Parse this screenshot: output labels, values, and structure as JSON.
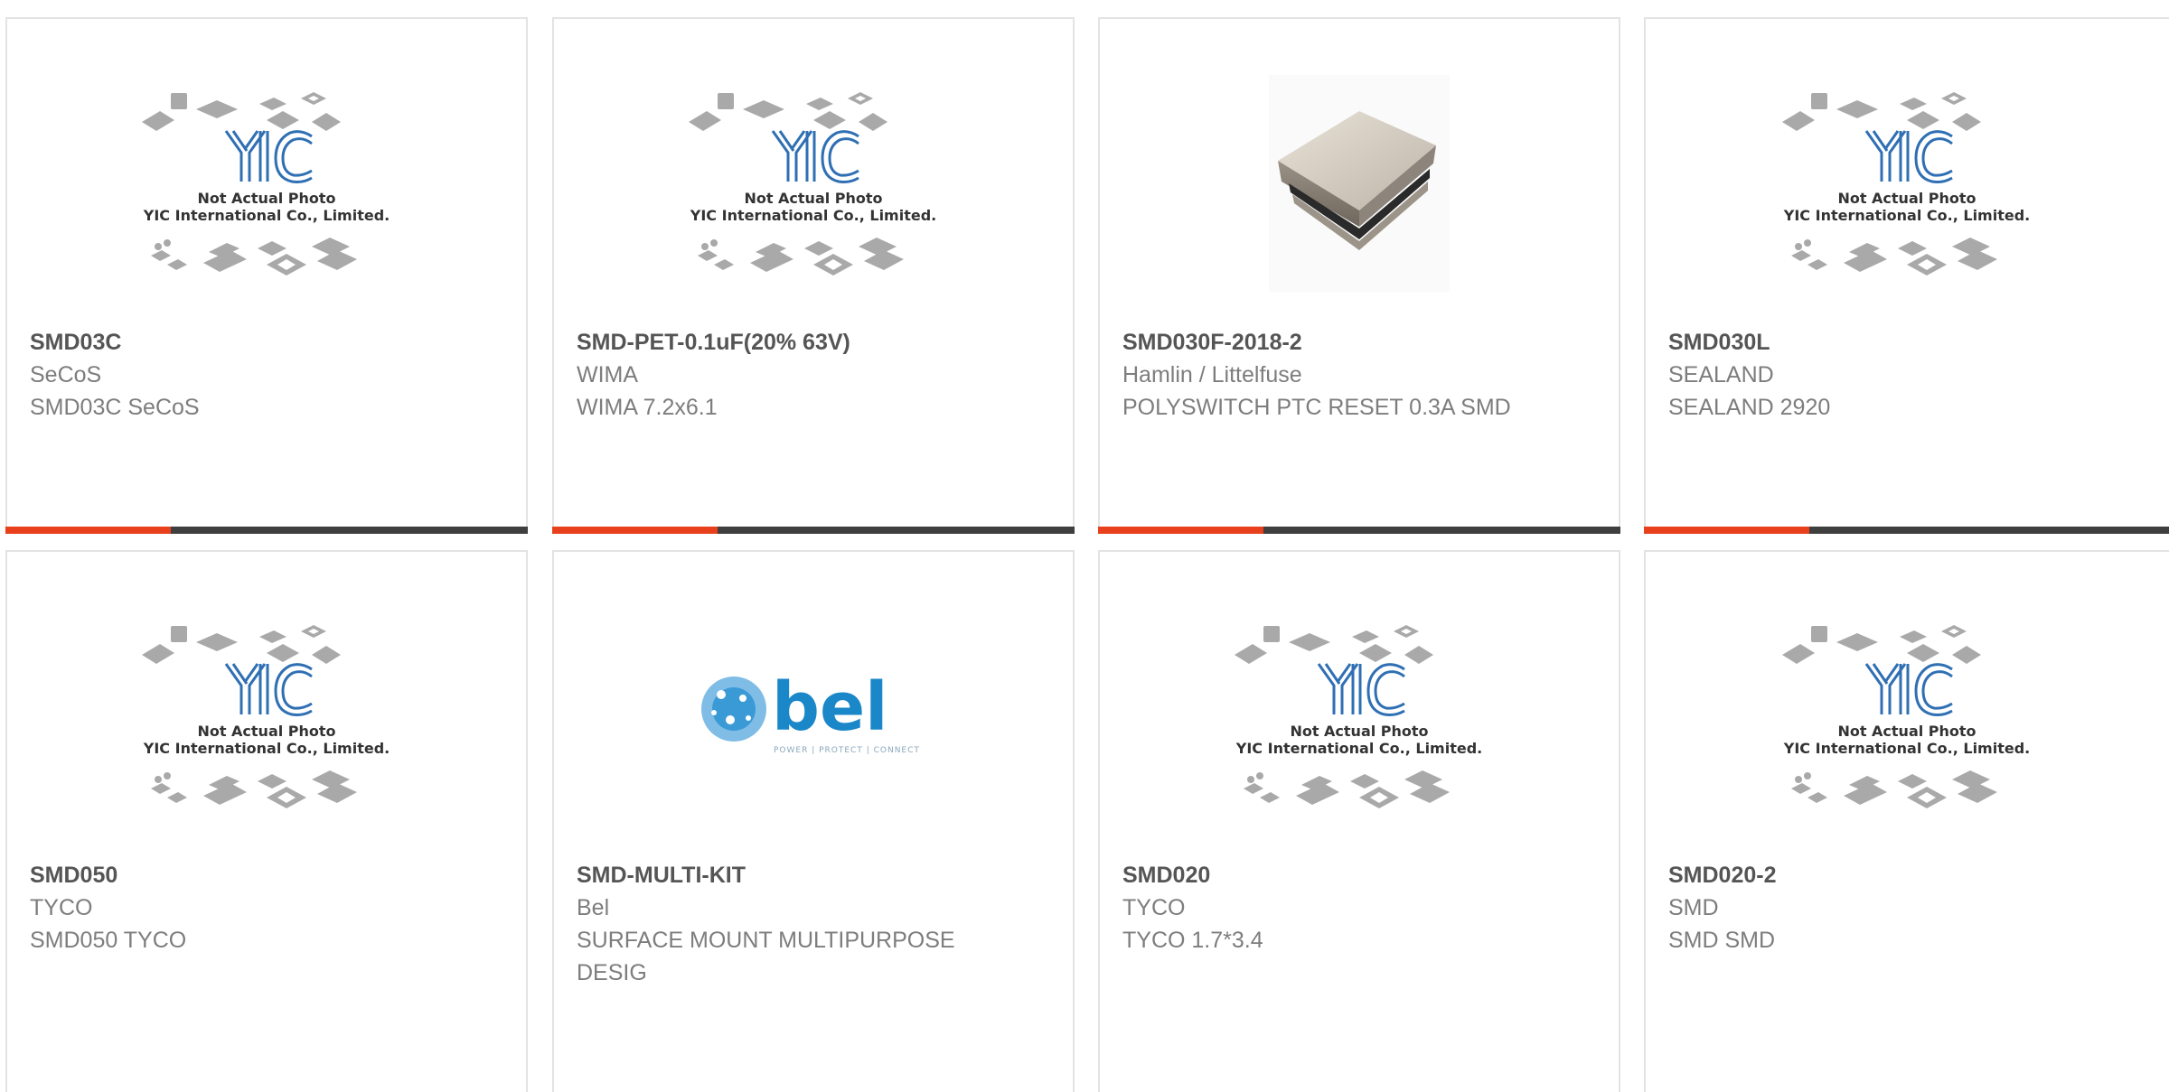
{
  "placeholder": {
    "brand": "YIC",
    "line1": "Not Actual Photo",
    "line2": "YIC International Co., Limited."
  },
  "bel_logo": {
    "brand": "bel",
    "tagline": "POWER | PROTECT | CONNECT"
  },
  "colors": {
    "accent": "#e8401c",
    "bar": "#3f3f3f",
    "yic_blue": "#2f6fb3",
    "bel_blue": "#1a87c9"
  },
  "products": [
    {
      "part": "SMD03C",
      "manufacturer": "SeCoS",
      "description": "SMD03C SeCoS",
      "image": "placeholder"
    },
    {
      "part": "SMD-PET-0.1uF(20% 63V)",
      "manufacturer": "WIMA",
      "description": "WIMA 7.2x6.1",
      "image": "placeholder"
    },
    {
      "part": "SMD030F-2018-2",
      "manufacturer": "Hamlin / Littelfuse",
      "description": "POLYSWITCH PTC RESET 0.3A SMD",
      "image": "component-photo"
    },
    {
      "part": "SMD030L",
      "manufacturer": "SEALAND",
      "description": "SEALAND 2920",
      "image": "placeholder"
    },
    {
      "part": "SMD050",
      "manufacturer": "TYCO",
      "description": "SMD050 TYCO",
      "image": "placeholder"
    },
    {
      "part": "SMD-MULTI-KIT",
      "manufacturer": "Bel",
      "description": "SURFACE MOUNT MULTIPURPOSE DESIG",
      "image": "bel-logo"
    },
    {
      "part": "SMD020",
      "manufacturer": "TYCO",
      "description": "TYCO 1.7*3.4",
      "image": "placeholder"
    },
    {
      "part": "SMD020-2",
      "manufacturer": "SMD",
      "description": "SMD SMD",
      "image": "placeholder"
    }
  ]
}
